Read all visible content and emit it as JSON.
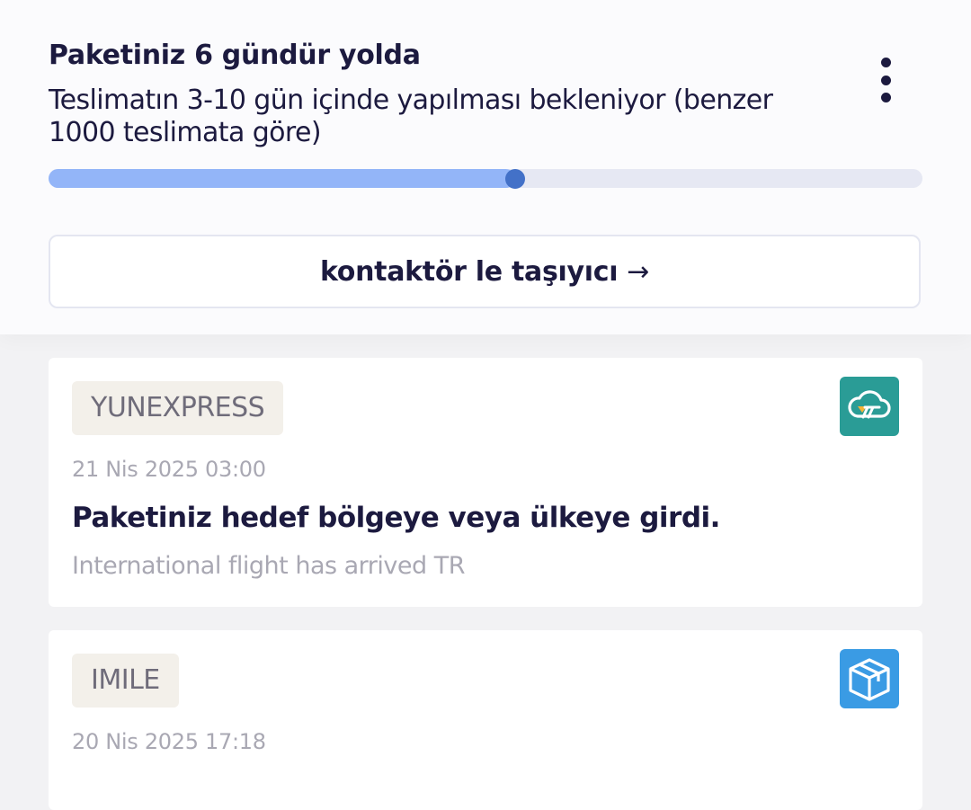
{
  "summary": {
    "title": "Paketiniz 6 gündür yolda",
    "subtitle": "Teslimatın 3-10 gün içinde yapılması bekleniyor (benzer 1000 teslimata göre)",
    "progress_percent": 53.4
  },
  "contact_button": {
    "label": "kontaktör le taşıyıcı",
    "arrow": "→"
  },
  "events": [
    {
      "carrier": "YUNEXPRESS",
      "logo_icon": "cloud-icon",
      "logo_color": "#2a9c96",
      "date": "21 Nis 2025 03:00",
      "title": "Paketiniz hedef bölgeye veya ülkeye girdi.",
      "detail": "International flight has arrived TR"
    },
    {
      "carrier": "IMILE",
      "logo_icon": "box-icon",
      "logo_color": "#3a9be4",
      "date": "20 Nis 2025 17:18"
    }
  ]
}
